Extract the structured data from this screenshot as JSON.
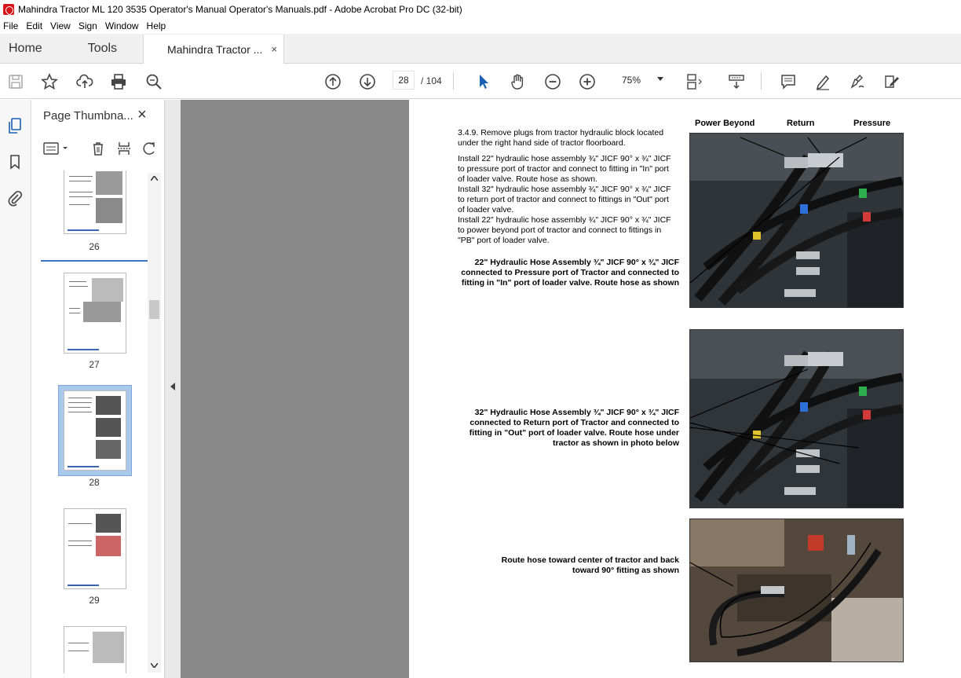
{
  "window": {
    "title": "Mahindra Tractor ML 120 3535 Operator's Manual Operator's Manuals.pdf - Adobe Acrobat Pro DC (32-bit)"
  },
  "menu": [
    "File",
    "Edit",
    "View",
    "Sign",
    "Window",
    "Help"
  ],
  "tabs": {
    "home": "Home",
    "tools": "Tools",
    "document": "Mahindra Tractor ...",
    "close": "×"
  },
  "toolbar": {
    "page_current": "28",
    "page_total": "/ 104",
    "zoom": "75%"
  },
  "panel": {
    "title": "Page Thumbna...",
    "close": "×",
    "thumbnails": [
      "26",
      "27",
      "28",
      "29"
    ]
  },
  "page": {
    "step": "3.4.9. Remove plugs from tractor hydraulic block located under the right hand side of tractor floorboard.",
    "para1": "Install 22\" hydraulic hose assembly ¾\" JICF 90° x ¾\" JICF to pressure port of tractor and connect to fitting in \"In\" port of loader valve. Route hose as shown.",
    "para2": "Install 32\" hydraulic hose assembly ¾\" JICF 90° x ¾\" JICF to return port of tractor and connect to fittings in \"Out\" port of loader valve.",
    "para3": "Install 22\" hydraulic hose assembly ¾\" JICF 90° x ¾\" JICF to power beyond port of tractor and connect to fittings in \"PB\" port of loader valve.",
    "caption1": "22\" Hydraulic Hose Assembly ¾\" JICF 90° x ¾\" JICF connected to Pressure port of Tractor and connected to fitting in \"In\" port of loader valve. Route hose as shown",
    "caption2": "32\" Hydraulic Hose Assembly ¾\" JICF 90° x ¾\" JICF connected to Return port of Tractor and connected to fitting in \"Out\" port of loader valve. Route hose under tractor as shown in photo below",
    "caption3": "Route hose toward center of tractor and back toward 90° fitting as shown",
    "label_power_beyond": "Power Beyond",
    "label_return": "Return",
    "label_pressure": "Pressure"
  }
}
